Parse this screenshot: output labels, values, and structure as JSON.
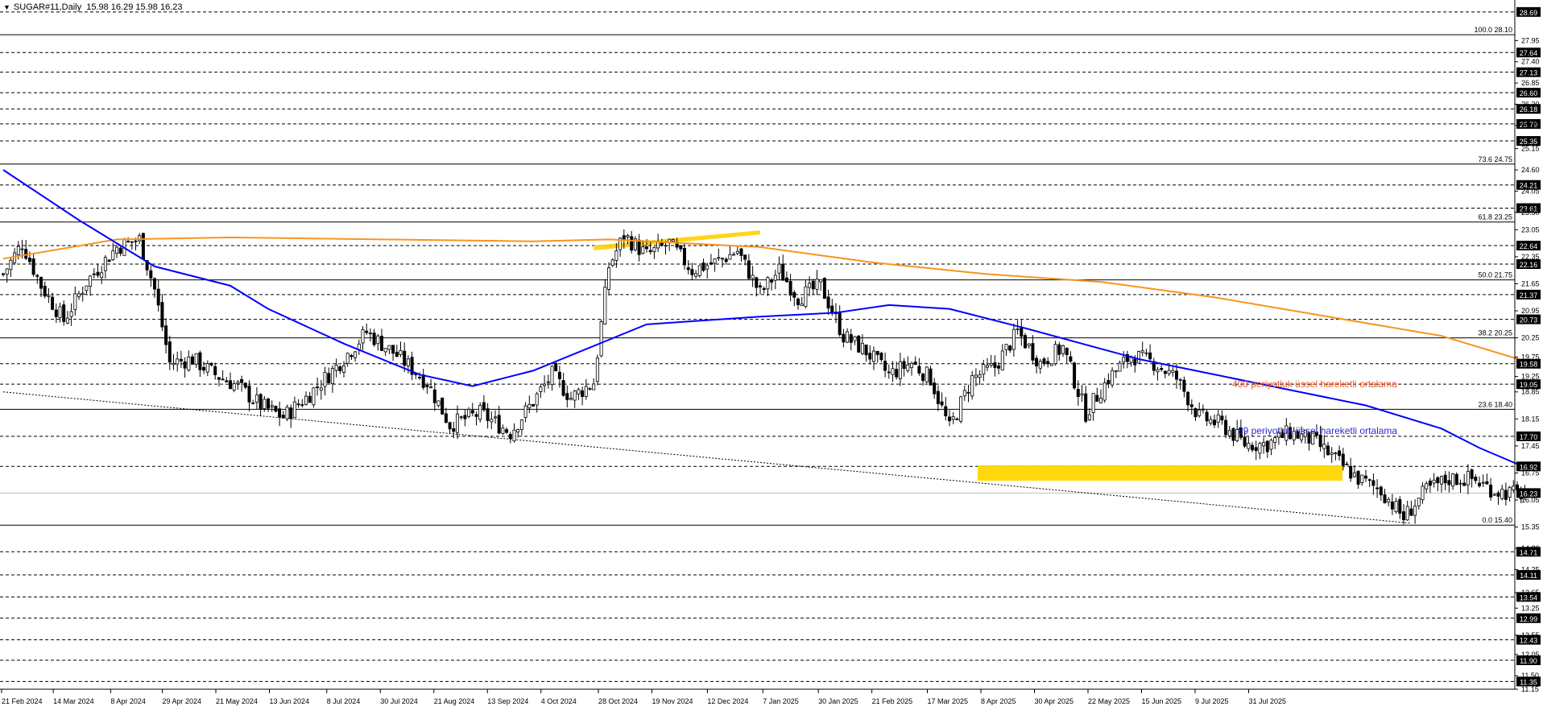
{
  "header": {
    "symbol": "SUGAR#11,Daily",
    "ohlc": "15.98 16.29 15.98 16.23"
  },
  "chart_data": {
    "type": "candlestick",
    "symbol": "SUGAR#11",
    "timeframe": "Daily",
    "ylim": [
      11.15,
      29.0
    ],
    "grid": false,
    "x_tick_labels": [
      "21 Feb 2024",
      "14 Mar 2024",
      "8 Apr 2024",
      "29 Apr 2024",
      "21 May 2024",
      "13 Jun 2024",
      "8 Jul 2024",
      "30 Jul 2024",
      "21 Aug 2024",
      "13 Sep 2024",
      "4 Oct 2024",
      "28 Oct 2024",
      "19 Nov 2024",
      "12 Dec 2024",
      "7 Jan 2025",
      "30 Jan 2025",
      "21 Feb 2025",
      "17 Mar 2025",
      "8 Apr 2025",
      "30 Apr 2025",
      "22 May 2025",
      "15 Jun 2025",
      "9 Jul 2025",
      "31 Jul 2025"
    ],
    "y_tick_labels": [
      "27.95",
      "27.40",
      "26.85",
      "26.30",
      "25.75",
      "25.15",
      "24.60",
      "24.05",
      "23.50",
      "23.05",
      "22.35",
      "21.65",
      "20.95",
      "20.25",
      "19.75",
      "19.25",
      "18.85",
      "18.15",
      "17.45",
      "16.75",
      "16.05",
      "15.35",
      "14.80",
      "14.25",
      "13.65",
      "13.25",
      "12.55",
      "12.05",
      "11.50",
      "11.15"
    ],
    "price_levels": [
      "28.69",
      "27.64",
      "27.13",
      "26.60",
      "26.18",
      "25.79",
      "25.35",
      "24.21",
      "23.61",
      "22.64",
      "22.16",
      "21.37",
      "20.73",
      "19.58",
      "19.05",
      "17.70",
      "16.92",
      "16.23",
      "14.71",
      "14.11",
      "13.54",
      "12.99",
      "12.43",
      "11.90",
      "11.35"
    ],
    "current_price": "16.23",
    "fibonacci": [
      {
        "label": "100.0 28.10",
        "value": 28.1
      },
      {
        "label": "73.6 24.75",
        "value": 24.75
      },
      {
        "label": "61.8 23.25",
        "value": 23.25
      },
      {
        "label": "50.0 21.75",
        "value": 21.75
      },
      {
        "label": "38.2 20.25",
        "value": 20.25
      },
      {
        "label": "23.6 18.40",
        "value": 18.4
      },
      {
        "label": "0.0 15.40",
        "value": 15.4
      }
    ],
    "anchors": [
      {
        "i": 0,
        "c": 21.9
      },
      {
        "i": 5,
        "c": 22.7
      },
      {
        "i": 10,
        "c": 21.6
      },
      {
        "i": 16,
        "c": 20.7
      },
      {
        "i": 22,
        "c": 21.7
      },
      {
        "i": 30,
        "c": 22.6
      },
      {
        "i": 36,
        "c": 22.8
      },
      {
        "i": 40,
        "c": 21.5
      },
      {
        "i": 44,
        "c": 19.6
      },
      {
        "i": 50,
        "c": 19.7
      },
      {
        "i": 56,
        "c": 19.3
      },
      {
        "i": 62,
        "c": 19.0
      },
      {
        "i": 68,
        "c": 18.5
      },
      {
        "i": 74,
        "c": 18.2
      },
      {
        "i": 80,
        "c": 18.7
      },
      {
        "i": 88,
        "c": 19.5
      },
      {
        "i": 96,
        "c": 20.4
      },
      {
        "i": 104,
        "c": 19.8
      },
      {
        "i": 112,
        "c": 19.1
      },
      {
        "i": 118,
        "c": 18.0
      },
      {
        "i": 126,
        "c": 18.3
      },
      {
        "i": 134,
        "c": 17.8
      },
      {
        "i": 140,
        "c": 18.6
      },
      {
        "i": 145,
        "c": 19.3
      },
      {
        "i": 150,
        "c": 18.7
      },
      {
        "i": 156,
        "c": 19.1
      },
      {
        "i": 160,
        "c": 22.1
      },
      {
        "i": 164,
        "c": 22.9
      },
      {
        "i": 170,
        "c": 22.4
      },
      {
        "i": 176,
        "c": 22.7
      },
      {
        "i": 182,
        "c": 22.0
      },
      {
        "i": 188,
        "c": 22.2
      },
      {
        "i": 194,
        "c": 22.5
      },
      {
        "i": 200,
        "c": 21.4
      },
      {
        "i": 205,
        "c": 22.0
      },
      {
        "i": 210,
        "c": 21.3
      },
      {
        "i": 216,
        "c": 21.6
      },
      {
        "i": 222,
        "c": 20.3
      },
      {
        "i": 228,
        "c": 19.9
      },
      {
        "i": 234,
        "c": 19.3
      },
      {
        "i": 240,
        "c": 19.6
      },
      {
        "i": 245,
        "c": 19.2
      },
      {
        "i": 250,
        "c": 17.9
      },
      {
        "i": 256,
        "c": 19.2
      },
      {
        "i": 262,
        "c": 19.5
      },
      {
        "i": 268,
        "c": 20.4
      },
      {
        "i": 274,
        "c": 19.6
      },
      {
        "i": 280,
        "c": 20.0
      },
      {
        "i": 286,
        "c": 18.3
      },
      {
        "i": 292,
        "c": 19.2
      },
      {
        "i": 298,
        "c": 19.8
      },
      {
        "i": 304,
        "c": 19.6
      },
      {
        "i": 310,
        "c": 19.2
      },
      {
        "i": 316,
        "c": 18.2
      },
      {
        "i": 322,
        "c": 18.0
      },
      {
        "i": 328,
        "c": 17.5
      },
      {
        "i": 334,
        "c": 17.5
      },
      {
        "i": 340,
        "c": 17.8
      },
      {
        "i": 346,
        "c": 17.6
      },
      {
        "i": 352,
        "c": 17.1
      },
      {
        "i": 358,
        "c": 16.6
      },
      {
        "i": 364,
        "c": 16.3
      },
      {
        "i": 370,
        "c": 15.6
      },
      {
        "i": 376,
        "c": 16.3
      },
      {
        "i": 382,
        "c": 16.6
      },
      {
        "i": 388,
        "c": 16.6
      },
      {
        "i": 394,
        "c": 16.3
      },
      {
        "i": 400,
        "c": 16.2
      },
      {
        "i": 402,
        "c": 16.23
      }
    ],
    "series": [
      {
        "name": "400 periyotluk üssel hareketli ortalama",
        "color": "#f7941d",
        "points": [
          [
            0,
            22.3
          ],
          [
            30,
            22.8
          ],
          [
            60,
            22.85
          ],
          [
            100,
            22.8
          ],
          [
            140,
            22.75
          ],
          [
            160,
            22.8
          ],
          [
            200,
            22.6
          ],
          [
            230,
            22.2
          ],
          [
            260,
            21.9
          ],
          [
            290,
            21.7
          ],
          [
            320,
            21.3
          ],
          [
            350,
            20.8
          ],
          [
            380,
            20.3
          ],
          [
            402,
            19.65
          ]
        ]
      },
      {
        "name": "89 periyotluk üssel hareketli ortalama",
        "color": "#0000ff",
        "points": [
          [
            0,
            24.6
          ],
          [
            20,
            23.3
          ],
          [
            40,
            22.1
          ],
          [
            60,
            21.6
          ],
          [
            70,
            21.0
          ],
          [
            90,
            20.1
          ],
          [
            110,
            19.3
          ],
          [
            124,
            19.0
          ],
          [
            140,
            19.4
          ],
          [
            170,
            20.6
          ],
          [
            200,
            20.8
          ],
          [
            220,
            20.9
          ],
          [
            234,
            21.1
          ],
          [
            250,
            21.0
          ],
          [
            270,
            20.5
          ],
          [
            300,
            19.7
          ],
          [
            320,
            19.3
          ],
          [
            340,
            18.9
          ],
          [
            360,
            18.5
          ],
          [
            380,
            17.9
          ],
          [
            390,
            17.4
          ],
          [
            402,
            16.9
          ]
        ]
      }
    ],
    "trendline": {
      "from": {
        "i": 0,
        "v": 18.85
      },
      "to": {
        "i": 372,
        "v": 15.45
      }
    },
    "zones": [
      {
        "from_i": 401,
        "to_i": 402,
        "v_low": 16.55,
        "v_high": 16.95,
        "color": "#ffd700"
      }
    ],
    "highlight": {
      "from_i": 156,
      "to_i": 200,
      "v_start": 22.6,
      "v_end": 22.95,
      "color": "#ffd000"
    },
    "annotations": [
      {
        "text": "400 periyotluk üssel hareketli ortalama",
        "color": "#f05a28"
      },
      {
        "text": "89 periyotluk üssel hareketli ortalama",
        "color": "#2b2bd6"
      }
    ]
  }
}
